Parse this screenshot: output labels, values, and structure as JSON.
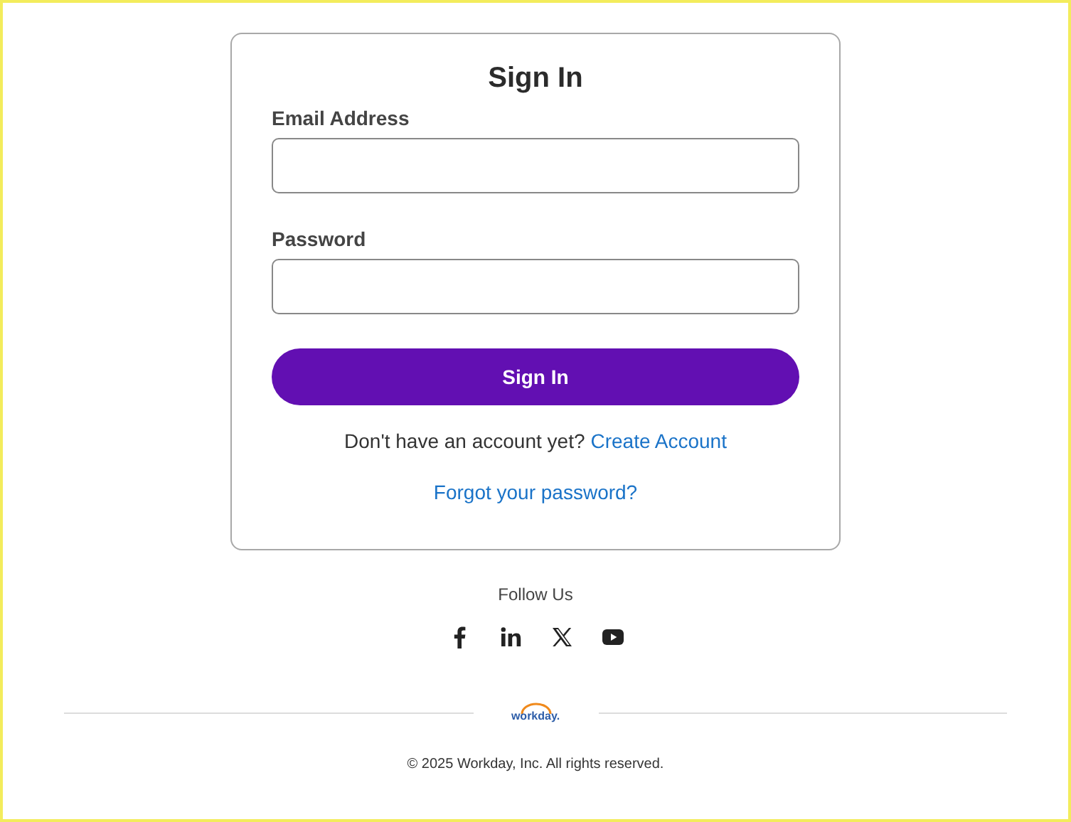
{
  "sign_in_card": {
    "title": "Sign In",
    "fields": [
      {
        "label": "Email Address"
      },
      {
        "label": "Password"
      }
    ],
    "submit_button": "Sign In",
    "account_prompt": {
      "text": "Don't have an account yet?",
      "link": "Create Account"
    },
    "forgot_link": "Forgot your password?"
  },
  "footer": {
    "follow_label": "Follow Us",
    "social_links": [
      {
        "kind": "facebook"
      },
      {
        "kind": "linkedin"
      },
      {
        "kind": "x"
      },
      {
        "kind": "youtube"
      }
    ],
    "logo_text": "workday.",
    "copyright": "© 2025 Workday, Inc. All rights reserved."
  }
}
